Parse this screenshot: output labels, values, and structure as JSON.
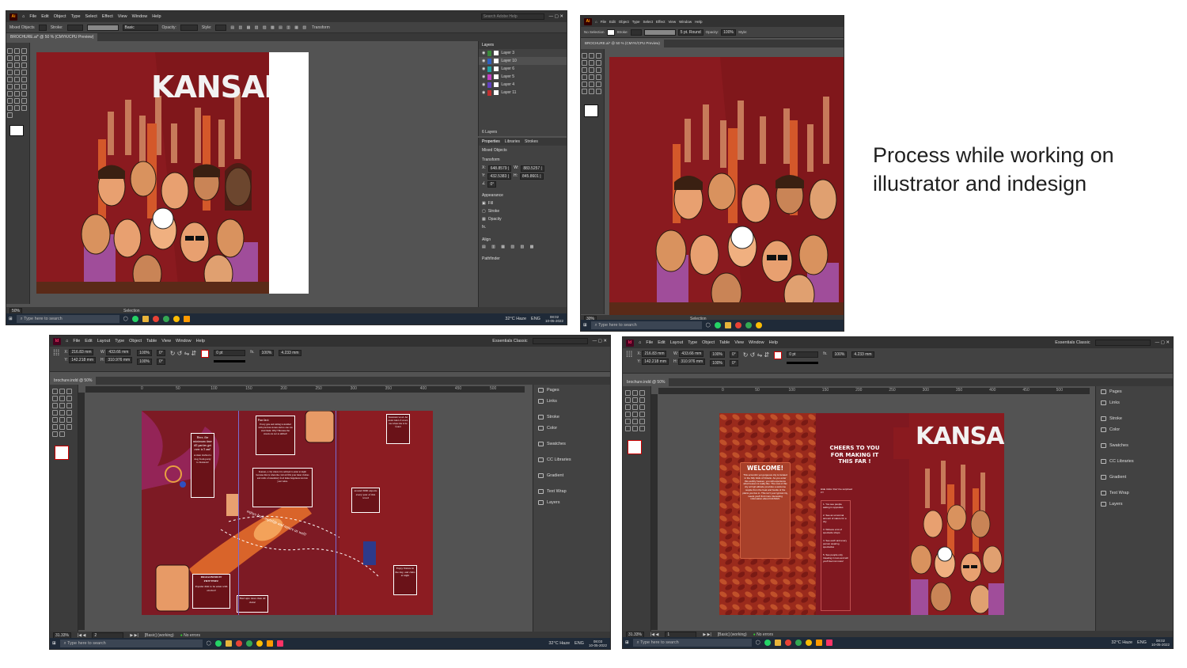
{
  "caption": "Process while working on illustrator and indesign",
  "illustrator": {
    "app_badge": "Ai",
    "menu": [
      "File",
      "Edit",
      "Object",
      "Type",
      "Select",
      "Effect",
      "View",
      "Window",
      "Help"
    ],
    "search_placeholder": "Search Adobe Help",
    "control_bar": {
      "selection_label": "Mixed Objects",
      "stroke_label": "Stroke:",
      "style_label": "Basic",
      "opacity_label": "Opacity:",
      "style2_label": "Style:",
      "transform_label": "Transform"
    },
    "doc_tab": "BROCHURE.ai* @ 50 % (CMYK/CPU Preview)",
    "layers_title": "Layers",
    "layers": [
      "Layer 3",
      "Layer 10",
      "Layer 6",
      "Layer 5",
      "Layer 4",
      "Layer 11"
    ],
    "layers_count": "6 Layers",
    "props_tabs": [
      "Properties",
      "Libraries",
      "Strokes"
    ],
    "props_selection": "Mixed Objects",
    "props_transform": "Transform",
    "props_x": "648.8579 |",
    "props_y": "432.5383 |",
    "props_w": "883.5257 |",
    "props_h": "845.8601 |",
    "props_angle": "0°",
    "props_appearance": "Appearance",
    "props_fill": "Fill",
    "props_stroke": "Stroke",
    "props_opacity": "Opacity",
    "props_fx": "fx.",
    "props_align": "Align",
    "props_pathfinder": "Pathfinder",
    "zoom": "50%",
    "status_tool": "Selection",
    "artwork_title": "KANSAN"
  },
  "illustrator2": {
    "control_bar": {
      "selection_label": "No Selection",
      "stroke_label": "Stroke:",
      "brush_label": "5 pt. Round",
      "opacity_label": "Opacity:",
      "opacity_value": "100%",
      "style_label": "Style:"
    },
    "doc_tab": "BROCHURE.ai* @ 50 % (CMYK/CPU Preview)",
    "zoom": "30%",
    "status_tool": "Selection"
  },
  "indesign": {
    "app_badge": "Id",
    "menu": [
      "File",
      "Edit",
      "Layout",
      "Type",
      "Object",
      "Table",
      "View",
      "Window",
      "Help"
    ],
    "workspace": "Essentials Classic",
    "control_bar": {
      "x": "216.83 mm",
      "y": "142.218 mm",
      "w": "433.66 mm",
      "h": "310.976 mm",
      "scale_x": "100%",
      "scale_y": "100%",
      "angle": "0°",
      "shear": "0°",
      "stroke_weight": "0 pt",
      "opacity": "100%",
      "tint_value": "4.233 mm"
    },
    "doc_tab": "brochure.indd @ 50%",
    "ruler_marks": [
      "0",
      "50",
      "100",
      "150",
      "200",
      "250",
      "300",
      "350",
      "400",
      "450",
      "500"
    ],
    "panels": [
      "Pages",
      "Links",
      "Stroke",
      "Color",
      "Swatches",
      "CC Libraries",
      "Gradient",
      "Text Wrap",
      "Layers"
    ],
    "zoom": "31.33%",
    "page": "2",
    "style": "[Basic] (working)",
    "preflight": "No errors",
    "panel1_text": "Here, the minimum time till parties get over is 5 am!",
    "panel1_sub": "A man invited a dog from party to Kansan!",
    "fun_fact_title": "Fun fact:",
    "fun_fact_text": "Every gate and railing is studded with precious stones and no one can steal them. Why? Because the streets are not as skilled!",
    "kansan_text": "Kansan, a city where it is advised to enter at night because that is when the cold air fills your inner clothes and walls of unsanitary food make happiness run into your veins.",
    "panel3_text": "Kanansan wood. An exotic kind of sword, use where she is be found",
    "panel4_text": "around 3000 exports every year of this wood",
    "panel5_text": "Enjoy Nature in the day, and clubs at night",
    "dragonfruit_title": "DRAGONFRUIT FRITTERS!",
    "dragonfruit_text": "Popular dish to be eaten with alcohol!",
    "find_text": "Find upto more than 40 clubs!",
    "curve_text": "enjoys both nightlife and nature as well!"
  },
  "indesign2": {
    "control_bar": {
      "x": "216.83 mm",
      "y": "142.218 mm",
      "w": "433.66 mm",
      "h": "310.976 mm",
      "scale_x": "100%",
      "scale_y": "100%",
      "angle": "0°",
      "shear": "0°",
      "stroke_weight": "0 pt",
      "opacity": "100%",
      "tint_value": "4.233 mm"
    },
    "doc_tab": "brochure.indd @ 50%",
    "zoom": "31.33%",
    "page": "1",
    "style": "[Basic] (working)",
    "preflight": "No errors",
    "welcome_title": "WELCOME!",
    "welcome_text": "This eccentric yet gorgeous city is located in the hilly folds of Ontario. As you enter this earthly heaven, you will experience what heaven is really like. The cost of this city at high altitude provides a welcome respite from the heat and bustle of the plains you live in. This isn't your typical city, meets you'll find more interesting information about KANSAN.",
    "cheers_title": "CHEERS TO YOU FOR MAKING IT THIS FAR !",
    "cheers_sub": "Hide tricks: Don't be surprised if !!",
    "cheers_items": [
      "1. You see people asking in opposites",
      "2. See an unnormal amount of nature for a city",
      "3. Witness a lot of spectacle shops",
      "4. See each and every person wearing spectacles",
      "5. See people only traveling in tuxs and will you'll feel not more!"
    ],
    "artwork_title": "KANSAN"
  },
  "taskbar": {
    "search": "Type here to search",
    "weather": "32°C Haze",
    "lang": "ENG",
    "time1": "08:02",
    "date1": "10-05-2022",
    "time2": "08:03",
    "date2": "10-05-2022",
    "time3": "08:02",
    "date3": "10-05-2022"
  },
  "colors": {
    "brochure_red": "#8a1a1f",
    "ai_orange": "#ff9a00",
    "id_pink": "#ff3366",
    "chrome_dark": "#323232"
  }
}
